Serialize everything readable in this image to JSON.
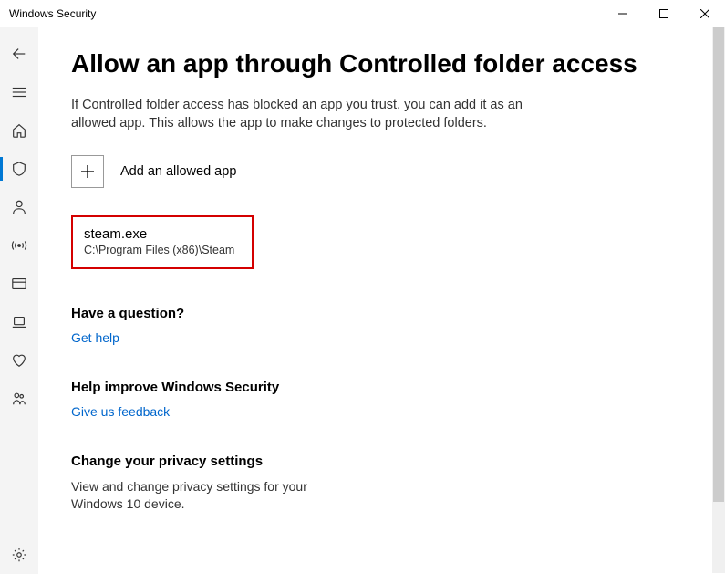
{
  "window": {
    "title": "Windows Security"
  },
  "page": {
    "title": "Allow an app through Controlled folder access",
    "description": "If Controlled folder access has blocked an app you trust, you can add it as an allowed app. This allows the app to make changes to protected folders."
  },
  "add_button": {
    "label": "Add an allowed app"
  },
  "allowed_app": {
    "name": "steam.exe",
    "path": "C:\\Program Files (x86)\\Steam"
  },
  "sections": {
    "question": {
      "title": "Have a question?",
      "link": "Get help"
    },
    "improve": {
      "title": "Help improve Windows Security",
      "link": "Give us feedback"
    },
    "privacy": {
      "title": "Change your privacy settings",
      "text": "View and change privacy settings for your Windows 10 device."
    }
  }
}
